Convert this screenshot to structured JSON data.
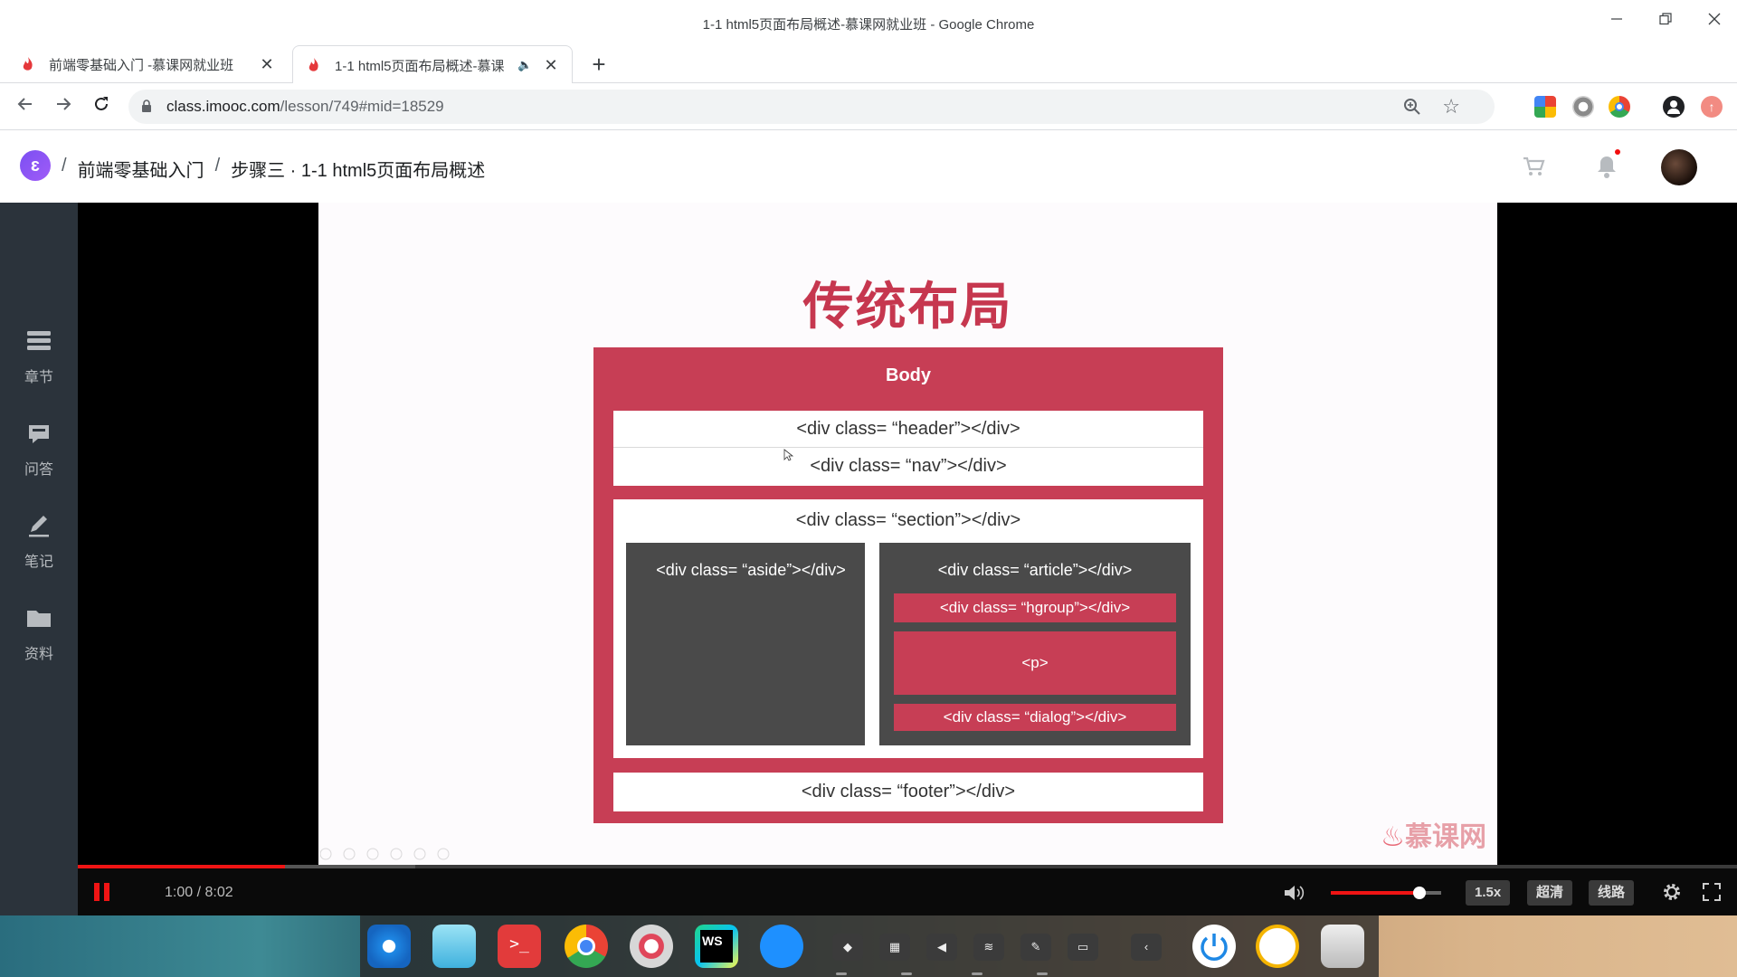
{
  "window": {
    "title": "1-1 html5页面布局概述-慕课网就业班 - Google Chrome"
  },
  "tabs": [
    {
      "label": "前端零基础入门 -慕课网就业班",
      "active": false
    },
    {
      "label": "1-1 html5页面布局概述-慕课",
      "active": true
    }
  ],
  "address": {
    "host": "class.imooc.com",
    "path": "/lesson/749#mid=18529"
  },
  "site": {
    "breadcrumb": [
      "前端零基础入门",
      "步骤三 · 1-1 html5页面布局概述"
    ],
    "brand_color": "#7b4ff2"
  },
  "rail": {
    "items": [
      {
        "label": "章节",
        "icon": "chapters-icon"
      },
      {
        "label": "问答",
        "icon": "qa-icon"
      },
      {
        "label": "笔记",
        "icon": "notes-icon"
      },
      {
        "label": "资料",
        "icon": "folder-icon"
      }
    ]
  },
  "slide": {
    "title": "传统布局",
    "body_label": "Body",
    "header": "<div class= “header”></div>",
    "nav": "<div class= “nav”></div>",
    "section": "<div class= “section”></div>",
    "aside": "<div class= “aside”></div>",
    "article": "<div class= “article”></div>",
    "hgroup": "<div class= “hgroup”></div>",
    "p": "<p>",
    "dialog": "<div class= “dialog”></div>",
    "footer": "<div class= “footer”></div>",
    "watermark": "慕课网",
    "accent": "#c73e55"
  },
  "player": {
    "time": "1:00 / 8:02",
    "progress": 0.1246,
    "buffered": 0.2036,
    "volume": 0.8,
    "speed": "1.5x",
    "quality": "超清",
    "route": "线路",
    "accent": "#f01414"
  }
}
